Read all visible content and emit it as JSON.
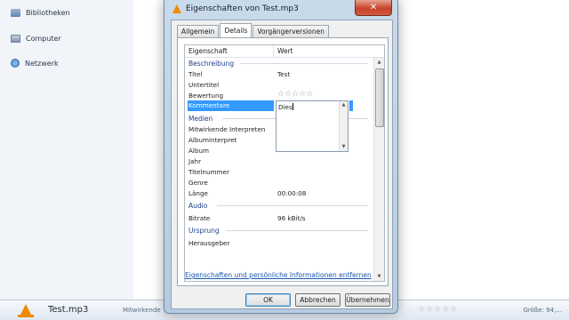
{
  "explorer": {
    "nav_items": [
      {
        "label": "Bibliotheken",
        "icon": "library-icon"
      },
      {
        "label": "Computer",
        "icon": "computer-icon"
      },
      {
        "label": "Netzwerk",
        "icon": "network-icon"
      }
    ],
    "details_bar": {
      "file_name": "Test.mp3",
      "sub_label": "Mitwirkende",
      "size_text": "Größe: 94,...",
      "rating_stars": 0
    }
  },
  "dialog": {
    "title": "Eigenschaften von Test.mp3",
    "close_label": "✕",
    "tabs": [
      {
        "label": "Allgemein",
        "active": false
      },
      {
        "label": "Details",
        "active": true
      },
      {
        "label": "Vorgängerversionen",
        "active": false
      }
    ],
    "columns": {
      "property": "Eigenschaft",
      "value": "Wert"
    },
    "groups": {
      "beschreibung": "Beschreibung",
      "medien": "Medien",
      "audio": "Audio",
      "ursprung": "Ursprung"
    },
    "rows": {
      "titel": {
        "name": "Titel",
        "value": "Test"
      },
      "untertitel": {
        "name": "Untertitel",
        "value": ""
      },
      "bewertung": {
        "name": "Bewertung",
        "stars": 5,
        "filled": 0
      },
      "kommentare": {
        "name": "Kommentare",
        "value": "Dies"
      },
      "mitwirkende": {
        "name": "Mitwirkende Interpreten",
        "value": ""
      },
      "albuminterpret": {
        "name": "Albuminterpret",
        "value": ""
      },
      "album": {
        "name": "Album",
        "value": ""
      },
      "jahr": {
        "name": "Jahr",
        "value": ""
      },
      "titelnummer": {
        "name": "Titelnummer",
        "value": ""
      },
      "genre": {
        "name": "Genre",
        "value": ""
      },
      "laenge": {
        "name": "Länge",
        "value": "00:00:08"
      },
      "bitrate": {
        "name": "Bitrate",
        "value": "96 kBit/s"
      },
      "herausgeber": {
        "name": "Herausgeber",
        "value": ""
      }
    },
    "link_text": "Eigenschaften und persönliche Informationen entfernen",
    "buttons": {
      "ok": "OK",
      "cancel": "Abbrechen",
      "apply": "Übernehmen"
    },
    "accent_color": "#3399ff"
  }
}
